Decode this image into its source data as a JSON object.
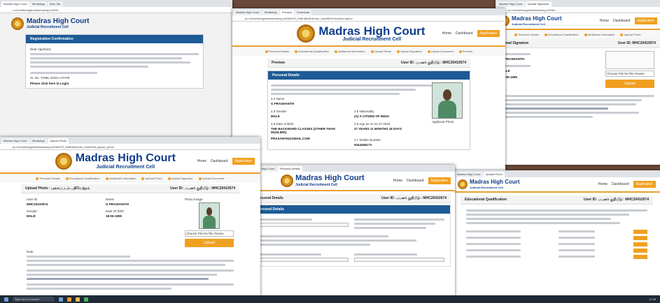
{
  "court_title": "Madras High Court",
  "court_subtitle": "Judicial Recruitment Cell",
  "nav": {
    "home": "Home",
    "dashboard": "Dashboard",
    "application": "Application"
  },
  "shot1": {
    "url": "c.mhcnetbengalurbatlonaveg.in/SMI/...",
    "panel_title": "Registration Confirmation",
    "greeting": "Dear Applicant,",
    "link": "Please click here to Login",
    "sign": "Sr. No. TAMIL NADU STATE"
  },
  "shot2": {
    "url": "jrc.mhcnetbengalurbatlonaveg.in/SMI/CR_EdtEdit&tEdit.doc_dwell&Preview&ud.aption",
    "steps": [
      "Personal Details",
      "Educational Qualification",
      "Additional Information",
      "Upload Photo",
      "Upload Signature",
      "Upload Document",
      "Preview"
    ],
    "bar_left": "Preview",
    "bar_right": "User ID: பயனர் குறியீடு : MHC20410574",
    "section": "Personal Details",
    "name_label": "2.2 Name",
    "name_value": "G PRASHANTH",
    "gender_label": "2.3 Gender",
    "gender_value": "MALE",
    "nationality_label": "2.5 Nationality",
    "nationality_value": "(A) A CITIZEN OF INDIA",
    "dob_label": "2.6 Date of Birth",
    "age_label": "2.8 Age as on 01.07.2023",
    "age_value": "27 YEARS 11 MONTHS 18 DAYS",
    "community_value": "THE BACKWARD CLASSES (OTHER THAN MUSLIMS)",
    "mobile_label": "2.7 Mobile Number",
    "mobile_value": "9344458173",
    "email_value": "PRASANTH@GMAIL.COM",
    "photo_caption": "Applicant Photo"
  },
  "shot3": {
    "url": "jrc.mhcnetbengalurbatlonaveg.in/SMI/...",
    "nav_short": [
      "Home",
      "Dashboard",
      "Application"
    ],
    "steps": [
      "Personal Details",
      "Educational Qualification",
      "Additional Information",
      "Upload Photo",
      "Upload Signature",
      "Upload Document"
    ],
    "bar_left": "Upload Signature",
    "bar_right": "User ID: MHC20410574",
    "name_value": "G PRASHANTH",
    "gender_value": "MALE",
    "dob_value": "18-06-1995",
    "choose_file": "Choose File  No file chosen",
    "upload": "Upload"
  },
  "shot4": {
    "url": "jrc.mhcnetbengalurbatlonaveg.in/SMI/CR_AddEdit/photo_Dwell/Hal-upload_photo",
    "bar_left": "Upload Photo : புகைப்படம் பதிவேற்றம்",
    "bar_right": "User ID: பயனர் குறியீடு : MHC20410574",
    "userid_label": "User ID",
    "userid_value": "MHC20410574",
    "name_label": "Name",
    "name_value": "G PRASHANTH",
    "gender_label": "Gender",
    "gender_value": "MALE",
    "dob_label": "Date Of Birth",
    "dob_value": "18-06-1995",
    "photo_label": "Photo Image",
    "choose_file": "Choose File  No file chosen",
    "upload": "Upload",
    "note": "Note"
  },
  "shot5": {
    "bar_left": "Personal Details",
    "bar_right": "User ID: பயனர் குறியீடு : MHC20410574",
    "section": "Personal Details"
  },
  "shot6": {
    "bar_left": "Educational Qualification",
    "bar_right": "User ID: பயனர் குறியீடு : MHC20410574"
  },
  "taskbar": {
    "search": "Type here to search",
    "time": "11:38"
  }
}
